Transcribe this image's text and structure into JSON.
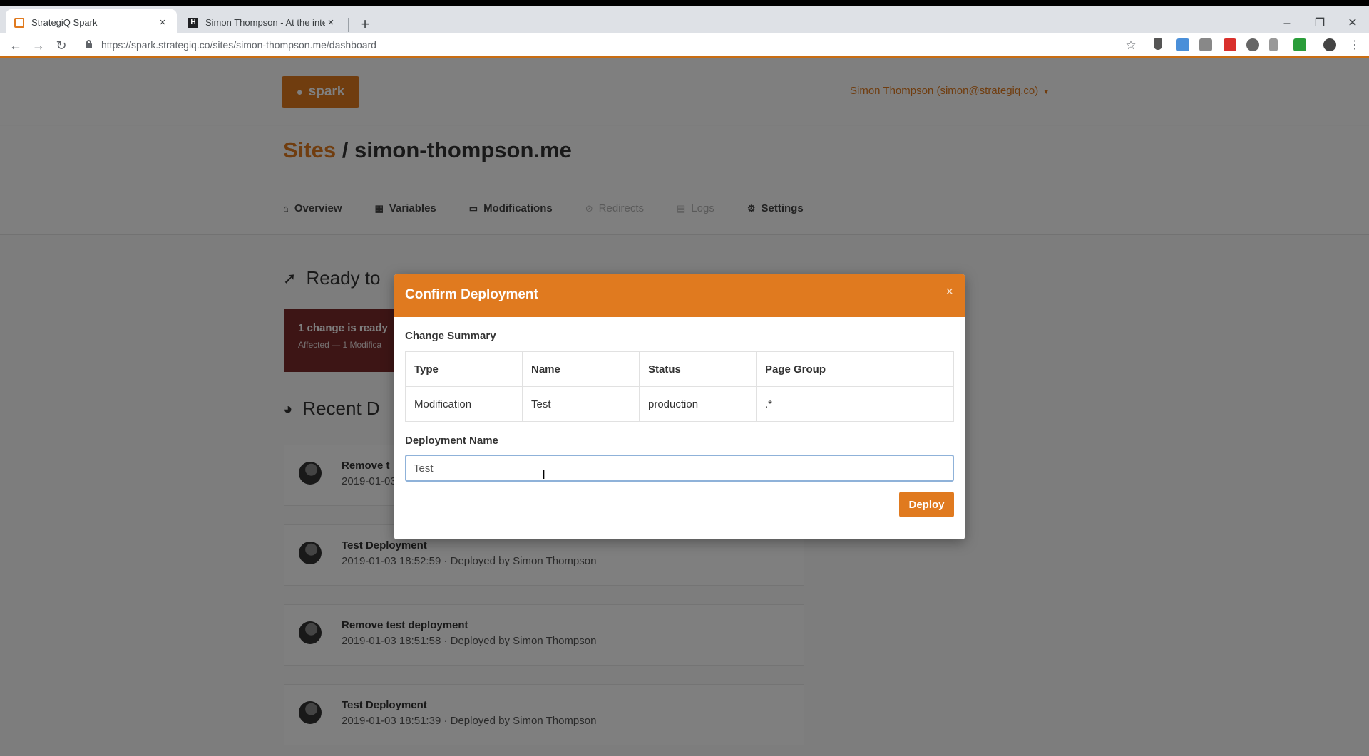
{
  "browser": {
    "tabs": [
      {
        "title": "StrategiQ Spark",
        "active": true
      },
      {
        "title": "Simon Thompson - At the inters",
        "active": false
      }
    ],
    "url": "https://spark.strategiq.co/sites/simon-thompson.me/dashboard"
  },
  "header": {
    "logo_text": "spark",
    "user_label": "Simon Thompson (simon@strategiq.co)"
  },
  "page": {
    "breadcrumb_root": "Sites",
    "breadcrumb_sep": "/",
    "site_name": "simon-thompson.me",
    "tabs": [
      {
        "label": "Overview",
        "icon": "home-icon"
      },
      {
        "label": "Variables",
        "icon": "grid-icon"
      },
      {
        "label": "Modifications",
        "icon": "monitor-icon"
      },
      {
        "label": "Redirects",
        "icon": "redirect-icon"
      },
      {
        "label": "Logs",
        "icon": "log-icon"
      },
      {
        "label": "Settings",
        "icon": "gear-icon"
      }
    ],
    "ready_heading": "Ready to",
    "ready_card": {
      "title": "1 change is ready",
      "subtitle": "Affected — 1 Modifica"
    },
    "recent_heading": "Recent D",
    "deployments": [
      {
        "title": "Remove t",
        "meta": "2019-01-03"
      },
      {
        "title": "Test Deployment",
        "meta": "2019-01-03 18:52:59 · Deployed by Simon Thompson"
      },
      {
        "title": "Remove test deployment",
        "meta": "2019-01-03 18:51:58 · Deployed by Simon Thompson"
      },
      {
        "title": "Test Deployment",
        "meta": "2019-01-03 18:51:39 · Deployed by Simon Thompson"
      }
    ]
  },
  "modal": {
    "title": "Confirm Deployment",
    "close": "×",
    "summary_label": "Change Summary",
    "columns": [
      "Type",
      "Name",
      "Status",
      "Page Group"
    ],
    "rows": [
      [
        "Modification",
        "Test",
        "production",
        ".*"
      ]
    ],
    "deployment_name_label": "Deployment Name",
    "deployment_name_value": "Test",
    "deploy_label": "Deploy"
  },
  "colors": {
    "accent": "#e07a1f",
    "focus_border": "#8fb2d9",
    "overlay": "rgba(0,0,0,0.5)"
  }
}
